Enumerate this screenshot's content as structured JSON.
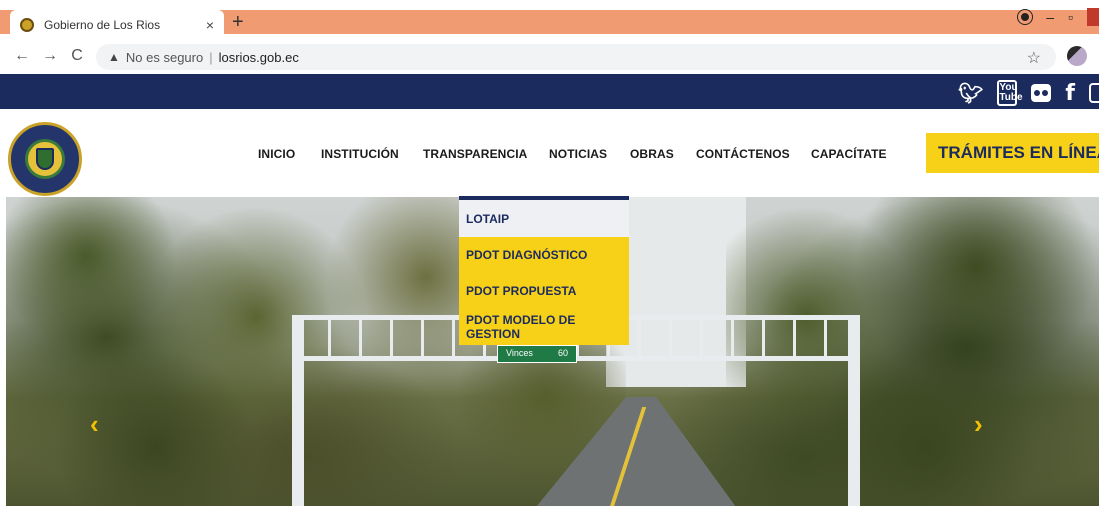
{
  "browser": {
    "tab_title": "Gobierno de Los Rios",
    "tab_close": "×",
    "new_tab": "+",
    "minimize": "–",
    "maximize": "▫",
    "back": "←",
    "forward": "→",
    "reload": "C",
    "security_label": "No es seguro",
    "separator": "|",
    "url": "losrios.gob.ec",
    "bookmark": "☆",
    "colors": {
      "tabbar_accent": "#f19b72"
    }
  },
  "social": {
    "items": [
      "twitter-icon",
      "youtube-icon",
      "flickr-icon",
      "facebook-icon",
      "instagram-icon"
    ],
    "youtube_text": "You\nTube",
    "facebook_text": "f"
  },
  "header": {
    "nav": [
      "INICIO",
      "INSTITUCIÓN",
      "TRANSPARENCIA",
      "NOTICIAS",
      "OBRAS",
      "CONTÁCTENOS",
      "CAPACÍTATE"
    ],
    "cta": "TRÁMITES EN LÍNEA",
    "colors": {
      "navy": "#1c2b5e",
      "yellow": "#f7d117"
    }
  },
  "dropdown": {
    "items": [
      "LOTAIP",
      "PDOT DIAGNÓSTICO",
      "PDOT PROPUESTA",
      "PDOT MODELO DE GESTION"
    ]
  },
  "hero": {
    "sign_city": "Vinces",
    "sign_distance": "60",
    "prev": "‹",
    "next": "›"
  }
}
